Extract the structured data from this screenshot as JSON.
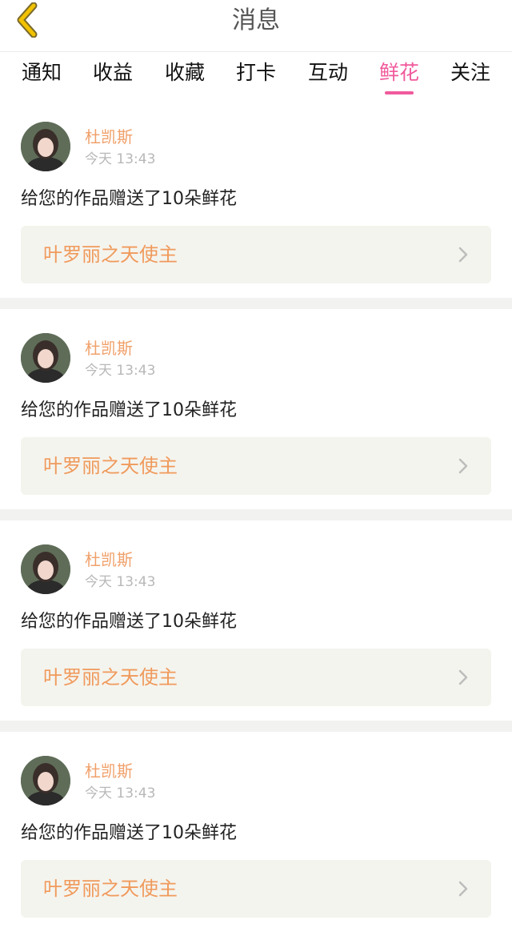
{
  "header": {
    "title": "消息",
    "back_icon": "chevron-left-icon",
    "back_color": "#f2c200"
  },
  "tabs": [
    {
      "label": "通知",
      "active": false
    },
    {
      "label": "收益",
      "active": false
    },
    {
      "label": "收藏",
      "active": false
    },
    {
      "label": "打卡",
      "active": false
    },
    {
      "label": "互动",
      "active": false
    },
    {
      "label": "鲜花",
      "active": true
    },
    {
      "label": "关注",
      "active": false
    }
  ],
  "accent_color": "#f05a9c",
  "notifications": [
    {
      "username": "杜凯斯",
      "time": "今天 13:43",
      "message": "给您的作品赠送了10朵鲜花",
      "work_title": "叶罗丽之天使主"
    },
    {
      "username": "杜凯斯",
      "time": "今天 13:43",
      "message": "给您的作品赠送了10朵鲜花",
      "work_title": "叶罗丽之天使主"
    },
    {
      "username": "杜凯斯",
      "time": "今天 13:43",
      "message": "给您的作品赠送了10朵鲜花",
      "work_title": "叶罗丽之天使主"
    },
    {
      "username": "杜凯斯",
      "time": "今天 13:43",
      "message": "给您的作品赠送了10朵鲜花",
      "work_title": "叶罗丽之天使主"
    }
  ]
}
